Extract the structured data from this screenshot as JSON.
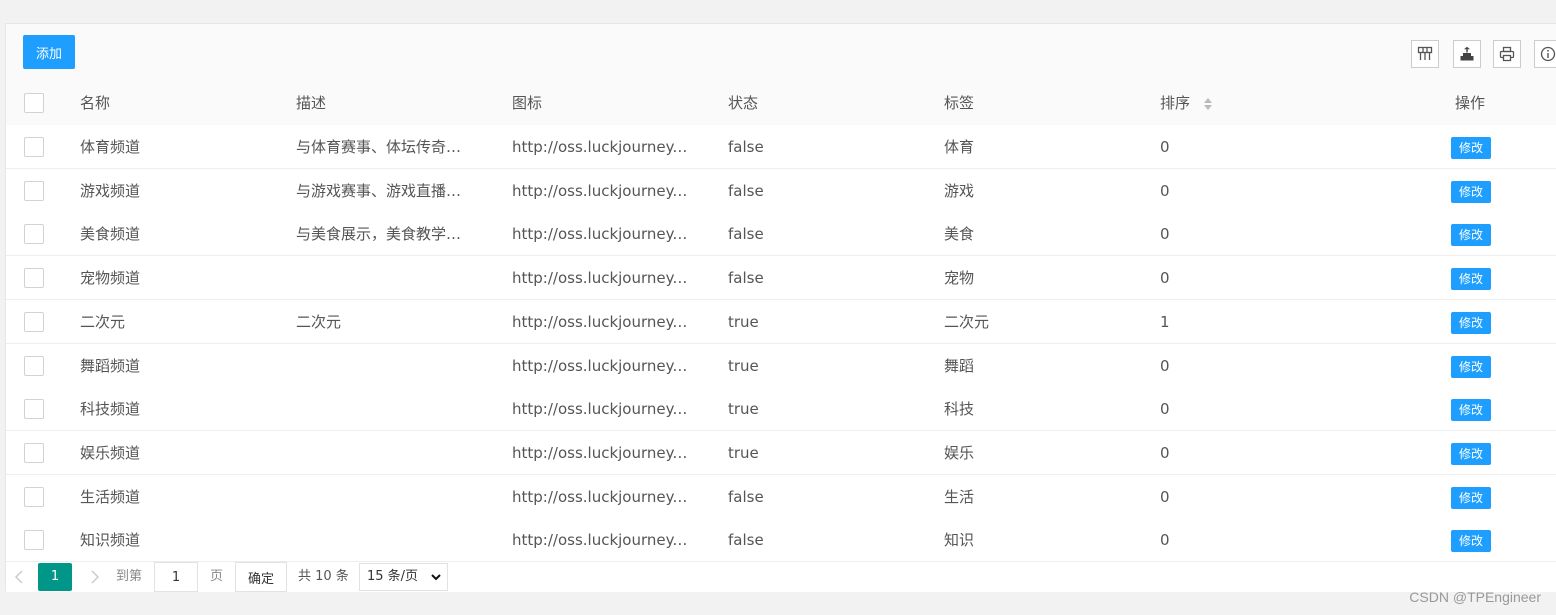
{
  "toolbar": {
    "add_label": "添加",
    "icons": [
      "columns-icon",
      "export-icon",
      "print-icon",
      "info-icon"
    ]
  },
  "table": {
    "columns": [
      "名称",
      "描述",
      "图标",
      "状态",
      "标签",
      "排序",
      "操作"
    ],
    "edit_label": "修改",
    "rows": [
      {
        "name": "体育频道",
        "desc": "与体育赛事、体坛传奇…",
        "icon": "http://oss.luckjourney.li…",
        "status": "false",
        "tag": "体育",
        "sort": "0"
      },
      {
        "name": "游戏频道",
        "desc": "与游戏赛事、游戏直播…",
        "icon": "http://oss.luckjourney.li…",
        "status": "false",
        "tag": "游戏",
        "sort": "0"
      },
      {
        "name": "美食频道",
        "desc": "与美食展示，美食教学…",
        "icon": "http://oss.luckjourney.li…",
        "status": "false",
        "tag": "美食",
        "sort": "0"
      },
      {
        "name": "宠物频道",
        "desc": "",
        "icon": "http://oss.luckjourney.li…",
        "status": "false",
        "tag": "宠物",
        "sort": "0"
      },
      {
        "name": "二次元",
        "desc": "二次元",
        "icon": "http://oss.luckjourney.li…",
        "status": "true",
        "tag": "二次元",
        "sort": "1"
      },
      {
        "name": "舞蹈频道",
        "desc": "",
        "icon": "http://oss.luckjourney.li…",
        "status": "true",
        "tag": "舞蹈",
        "sort": "0"
      },
      {
        "name": "科技频道",
        "desc": "",
        "icon": "http://oss.luckjourney.li…",
        "status": "true",
        "tag": "科技",
        "sort": "0"
      },
      {
        "name": "娱乐频道",
        "desc": "",
        "icon": "http://oss.luckjourney.li…",
        "status": "true",
        "tag": "娱乐",
        "sort": "0"
      },
      {
        "name": "生活频道",
        "desc": "",
        "icon": "http://oss.luckjourney.li…",
        "status": "false",
        "tag": "生活",
        "sort": "0"
      },
      {
        "name": "知识频道",
        "desc": "",
        "icon": "http://oss.luckjourney.li…",
        "status": "false",
        "tag": "知识",
        "sort": "0"
      }
    ]
  },
  "pager": {
    "current_page": "1",
    "goto_label": "到第",
    "goto_value": "1",
    "page_unit": "页",
    "confirm_label": "确定",
    "total_label": "共 10 条",
    "page_size": "15 条/页"
  },
  "watermark": "CSDN @TPEngineer",
  "colors": {
    "primary": "#1e9fff",
    "pager_active": "#009688"
  }
}
